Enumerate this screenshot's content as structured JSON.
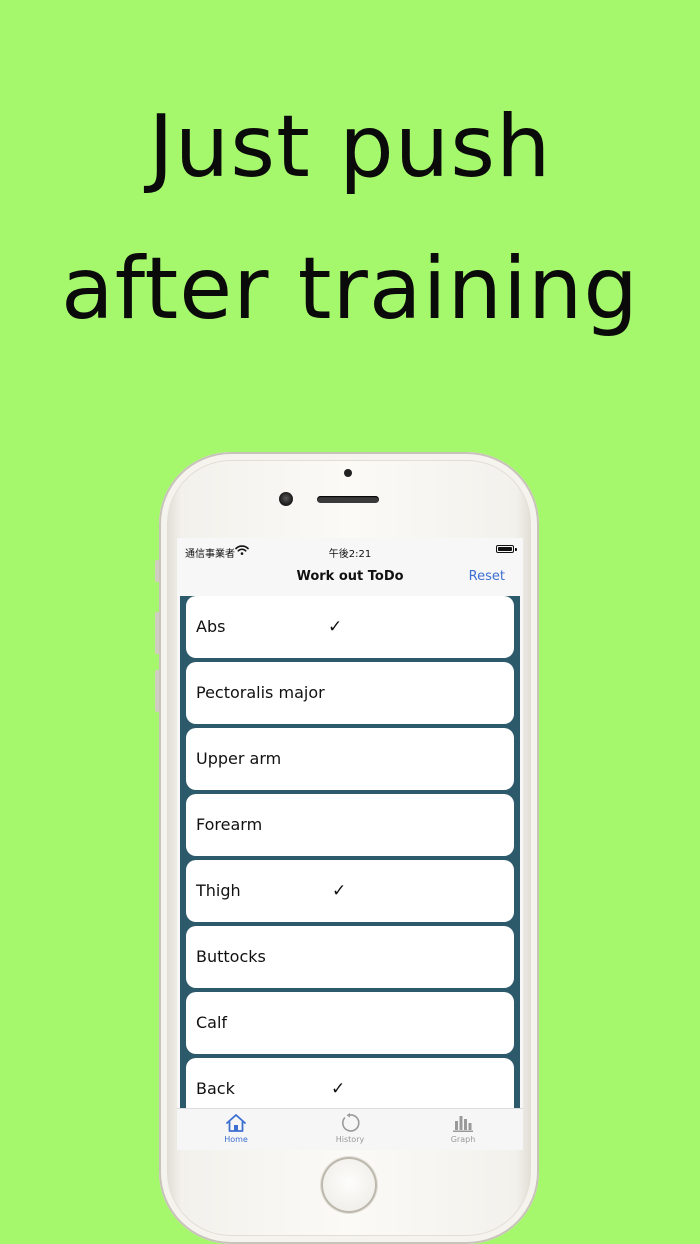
{
  "headline": {
    "line1": "Just push",
    "line2": "after training"
  },
  "status_bar": {
    "carrier": "通信事業者",
    "time": "午後2:21"
  },
  "nav": {
    "title": "Work out ToDo",
    "reset_label": "Reset"
  },
  "rows": [
    {
      "label": "Abs",
      "check": "✓"
    },
    {
      "label": "Pectoralis major",
      "check": ""
    },
    {
      "label": "Upper arm",
      "check": ""
    },
    {
      "label": "Forearm",
      "check": ""
    },
    {
      "label": "Thigh",
      "check": "✓"
    },
    {
      "label": "Buttocks",
      "check": ""
    },
    {
      "label": "Calf",
      "check": ""
    },
    {
      "label": "Back",
      "check": "✓"
    }
  ],
  "tabs": [
    {
      "label": "Home",
      "icon": "home-icon",
      "selected": true
    },
    {
      "label": "History",
      "icon": "history-icon",
      "selected": false
    },
    {
      "label": "Graph",
      "icon": "graph-icon",
      "selected": false
    }
  ],
  "colors": {
    "background": "#a5f76c",
    "list_background": "#2c5a6a",
    "accent": "#3d6fd1",
    "tab_inactive": "#9a9a9a"
  }
}
